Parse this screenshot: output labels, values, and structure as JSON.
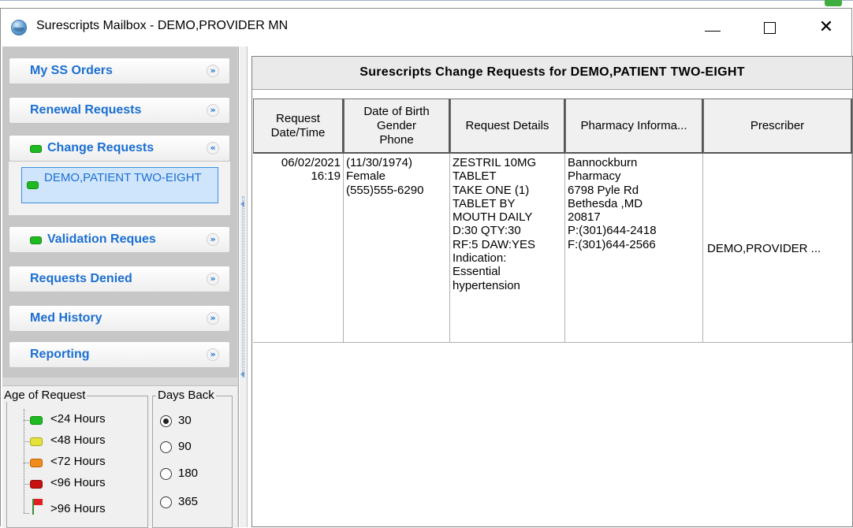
{
  "window": {
    "title": "Surescripts Mailbox - DEMO,PROVIDER MN",
    "minimize_symbol": "—",
    "maximize_symbol": "☐",
    "close_symbol": "✕"
  },
  "sidebar": {
    "sections": [
      {
        "label": "My SS Orders",
        "chevron": "»",
        "expanded": false,
        "indicator": null
      },
      {
        "label": "Renewal Requests",
        "chevron": "»",
        "expanded": false,
        "indicator": null
      },
      {
        "label": "Change Requests",
        "chevron": "«",
        "expanded": true,
        "indicator": "green"
      },
      {
        "label": "Validation Reques",
        "chevron": "»",
        "expanded": false,
        "indicator": "green"
      },
      {
        "label": "Requests Denied",
        "chevron": "»",
        "expanded": false,
        "indicator": null
      },
      {
        "label": "Med History",
        "chevron": "»",
        "expanded": false,
        "indicator": null
      },
      {
        "label": "Reporting",
        "chevron": "»",
        "expanded": false,
        "indicator": null
      }
    ],
    "change_requests_items": [
      {
        "label": "DEMO,PATIENT TWO-EIGHT",
        "indicator": "green",
        "selected": true
      }
    ]
  },
  "legend": {
    "age_title": "Age of Request",
    "age_items": [
      {
        "label": "<24 Hours",
        "color": "#21b921",
        "icon": "green-pill-icon"
      },
      {
        "label": "<48 Hours",
        "color": "#d6d62a",
        "icon": "yellow-pill-icon"
      },
      {
        "label": "<72 Hours",
        "color": "#f08c1c",
        "icon": "orange-pill-icon"
      },
      {
        "label": "<96 Hours",
        "color": "#d01515",
        "icon": "red-pill-icon"
      },
      {
        "label": ">96 Hours",
        "color": "#e02020",
        "icon": "red-flag-icon"
      }
    ],
    "days_title": "Days Back",
    "days_options": [
      "30",
      "90",
      "180",
      "365"
    ],
    "days_selected": "30"
  },
  "main": {
    "header": "Surescripts Change Requests for DEMO,PATIENT TWO-EIGHT",
    "columns": [
      "Request\nDate/Time",
      "Date of Birth\nGender\nPhone",
      "Request Details",
      "Pharmacy Informa...",
      "Prescriber"
    ],
    "rows": [
      {
        "datetime": "06/02/2021\n16:19",
        "patient": "(11/30/1974)\nFemale\n(555)555-6290",
        "details": "ZESTRIL 10MG\nTABLET\nTAKE ONE (1)\nTABLET BY\nMOUTH DAILY\nD:30 QTY:30\nRF:5 DAW:YES\nIndication:\nEssential\nhypertension",
        "pharmacy": "Bannockburn\nPharmacy\n6798 Pyle Rd\nBethesda ,MD\n20817\nP:(301)644-2418\nF:(301)644-2566",
        "prescriber": "DEMO,PROVIDER ..."
      }
    ]
  },
  "colors": {
    "accent_blue": "#1b6fd2",
    "selection_bg": "#cfe5fb",
    "indicator_green": "#21b921"
  }
}
